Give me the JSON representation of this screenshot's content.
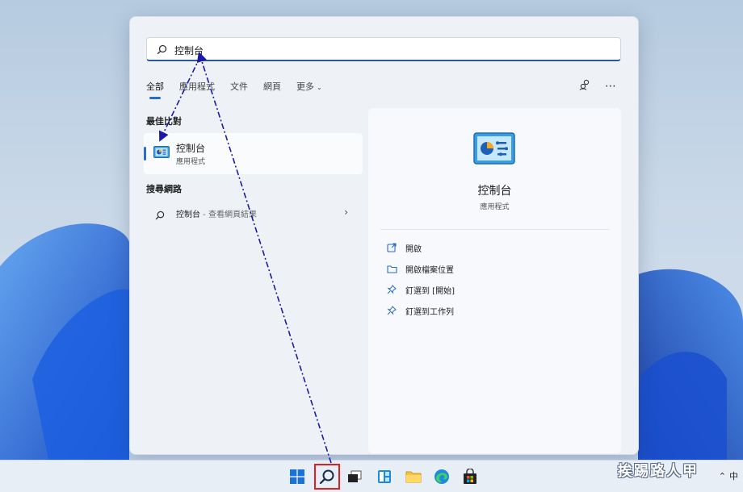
{
  "search": {
    "value": "控制台",
    "placeholder": ""
  },
  "tabs": [
    {
      "label": "全部",
      "active": true
    },
    {
      "label": "應用程式"
    },
    {
      "label": "文件"
    },
    {
      "label": "網頁"
    },
    {
      "label": "更多"
    }
  ],
  "sections": {
    "best_match": "最佳比對",
    "search_web": "搜尋網路"
  },
  "best_match": {
    "name": "控制台",
    "type": "應用程式"
  },
  "web_result": {
    "query": "控制台",
    "suffix": " - 查看網頁結果"
  },
  "detail": {
    "title": "控制台",
    "subtitle": "應用程式",
    "actions": [
      {
        "label": "開啟",
        "icon": "open-external-icon"
      },
      {
        "label": "開啟檔案位置",
        "icon": "folder-icon"
      },
      {
        "label": "釘選到 [開始]",
        "icon": "pin-icon"
      },
      {
        "label": "釘選到工作列",
        "icon": "pin-icon"
      }
    ]
  },
  "tray": {
    "ime": "中"
  },
  "watermark": "挨踢路人甲",
  "colors": {
    "accent": "#2b6cc4",
    "annotation": "#1a1aa6",
    "highlight_box": "#e02020"
  }
}
